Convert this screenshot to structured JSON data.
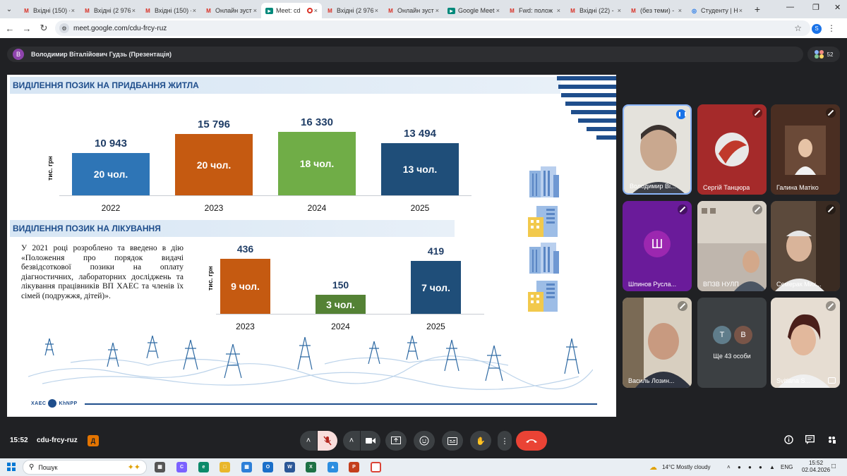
{
  "browser": {
    "tabs": [
      {
        "icon": "gmail",
        "label": "Вхідні (150) -",
        "active": false
      },
      {
        "icon": "gmail",
        "label": "Вхідні (2 976)",
        "active": false
      },
      {
        "icon": "gmail",
        "label": "Вхідні (150) -",
        "active": false
      },
      {
        "icon": "gmail",
        "label": "Онлайн зуст",
        "active": false
      },
      {
        "icon": "meet",
        "label": "Meet: cd",
        "active": true
      },
      {
        "icon": "gmail",
        "label": "Вхідні (2 976)",
        "active": false
      },
      {
        "icon": "gmail",
        "label": "Онлайн зуст",
        "active": false
      },
      {
        "icon": "meet",
        "label": "Google Meet",
        "active": false
      },
      {
        "icon": "gmail",
        "label": "Fwd: полож",
        "active": false
      },
      {
        "icon": "gmail",
        "label": "Вхідні (22) -",
        "active": false
      },
      {
        "icon": "gmail",
        "label": "(без теми) -",
        "active": false
      },
      {
        "icon": "globe",
        "label": "Студенту | Н",
        "active": false
      }
    ],
    "url": "meet.google.com/cdu-frcy-ruz",
    "profile_initial": "S"
  },
  "meeting": {
    "presenter_initial": "В",
    "presenter_label": "Володимир Віталійович Гудзь (Презентація)",
    "participant_count": "52",
    "time": "15:52",
    "code": "cdu-frcy-ruz"
  },
  "slide": {
    "section1_title": "ВИДІЛЕННЯ ПОЗИК НА ПРИДБАННЯ ЖИТЛА",
    "section2_title": "ВИДІЛЕННЯ ПОЗИК НА ЛІКУВАННЯ",
    "description": "У 2021 році розроблено та введено в дію «Положення про порядок видачі безвідсоткової позики на оплату діагностичних, лабораторних досліджень та лікування працівників ВП ХАЕС та членів їх сімей (подружжя, дітей)».",
    "footer_logo_left": "ХАЕС",
    "footer_logo_right": "KhNPP"
  },
  "chart_data": [
    {
      "type": "bar",
      "title": "ВИДІЛЕННЯ ПОЗИК НА ПРИДБАННЯ ЖИТЛА",
      "ylabel": "тис. грн",
      "categories": [
        "2022",
        "2023",
        "2024",
        "2025"
      ],
      "values": [
        10943,
        15796,
        16330,
        13494
      ],
      "value_labels": [
        "10 943",
        "15 796",
        "16 330",
        "13 494"
      ],
      "bar_labels": [
        "20 чол.",
        "20 чол.",
        "18 чол.",
        "13 чол."
      ],
      "colors": [
        "#2e75b6",
        "#c55a11",
        "#70ad47",
        "#1f4e79"
      ]
    },
    {
      "type": "bar",
      "title": "ВИДІЛЕННЯ ПОЗИК НА ЛІКУВАННЯ",
      "ylabel": "тис. грн",
      "categories": [
        "2023",
        "2024",
        "2025"
      ],
      "values": [
        436,
        150,
        419
      ],
      "value_labels": [
        "436",
        "150",
        "419"
      ],
      "bar_labels": [
        "9 чол.",
        "3 чол.",
        "7 чол."
      ],
      "colors": [
        "#c55a11",
        "#548235",
        "#1f4e79"
      ]
    }
  ],
  "participants": [
    {
      "name": "Володимир Ві...",
      "state": "speaking"
    },
    {
      "name": "Сергій Танцюра",
      "state": "muted"
    },
    {
      "name": "Галина Матіко",
      "state": "muted"
    },
    {
      "name": "Шпинов Русла...",
      "state": "muted",
      "initial": "Ш"
    },
    {
      "name": "ВПЗВ НУЛП",
      "state": "muted"
    },
    {
      "name": "Семерак Мих...",
      "state": "muted"
    },
    {
      "name": "Василь Лозин...",
      "state": "muted"
    },
    {
      "name": "Ще 43 особи",
      "avatars": [
        "Т",
        "В"
      ]
    },
    {
      "name": "Svitlana S...",
      "state": "muted"
    }
  ],
  "taskbar": {
    "search_label": "Пошук",
    "weather": "14°C  Mostly cloudy",
    "language": "ENG",
    "clock_time": "15:52",
    "clock_date": "02.04.2026"
  }
}
